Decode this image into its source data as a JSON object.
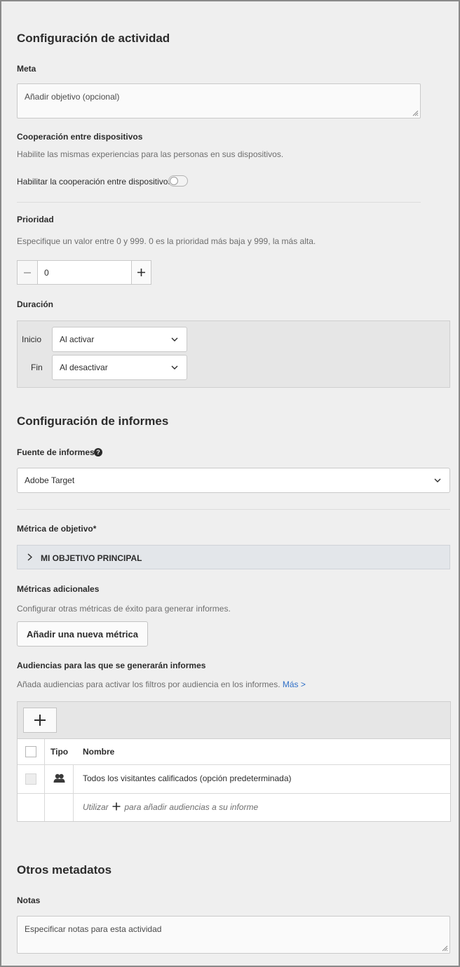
{
  "activity": {
    "title": "Configuración de actividad",
    "goal_label": "Meta",
    "goal_placeholder": "Añadir objetivo (opcional)",
    "cross_device_title": "Cooperación entre dispositivos",
    "cross_device_desc": "Habilite las mismas experiencias para las personas en sus dispositivos.",
    "cross_device_toggle_label": "Habilitar la cooperación entre dispositivos",
    "cross_device_enabled": false,
    "priority_label": "Prioridad",
    "priority_desc": "Especifique un valor entre 0 y 999. 0 es la prioridad más baja y 999, la más alta.",
    "priority_value": "0",
    "duration_label": "Duración",
    "start_label": "Inicio",
    "start_value": "Al activar",
    "end_label": "Fin",
    "end_value": "Al desactivar"
  },
  "reporting": {
    "title": "Configuración de informes",
    "source_label": "Fuente de informes",
    "source_value": "Adobe Target",
    "goal_metric_label": "Métrica de objetivo*",
    "goal_metric_item": "MI OBJETIVO PRINCIPAL",
    "additional_metrics_label": "Métricas adicionales",
    "additional_metrics_desc": "Configurar otras métricas de éxito para generar informes.",
    "add_metric_button": "Añadir una nueva métrica",
    "audiences_label": "Audiencias para las que se generarán informes",
    "audiences_desc": "Añada audiencias para activar los filtros por audiencia en los informes.",
    "audiences_more_link": "Más >",
    "table": {
      "columns": [
        "Tipo",
        "Nombre"
      ],
      "rows": [
        {
          "type_icon": "people-icon",
          "name": "Todos los visitantes calificados (opción predeterminada)"
        }
      ],
      "hint_prefix": "Utilizar",
      "hint_suffix": "para añadir audiencias a su informe"
    }
  },
  "other": {
    "title": "Otros metadatos",
    "notes_label": "Notas",
    "notes_placeholder": "Especificar notas para esta actividad"
  },
  "icons": {
    "minus": "minus-icon",
    "plus": "plus-icon",
    "chevron_down": "chevron-down-icon",
    "chevron_right": "chevron-right-icon",
    "help": "help-icon",
    "people": "people-icon"
  },
  "colors": {
    "background": "#efefef",
    "link": "#2f6fc7"
  }
}
